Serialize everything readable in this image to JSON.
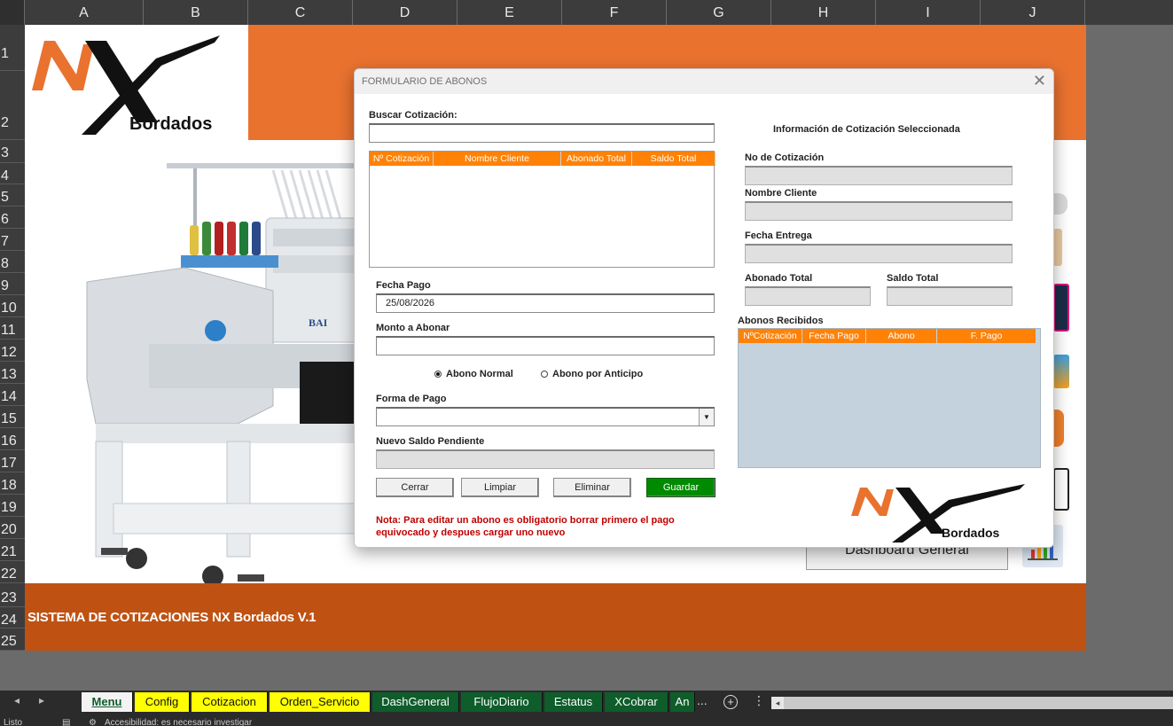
{
  "spreadsheet": {
    "columns": [
      "A",
      "B",
      "C",
      "D",
      "E",
      "F",
      "G",
      "H",
      "I",
      "J"
    ],
    "rows": [
      "1",
      "2",
      "3",
      "4",
      "5",
      "6",
      "7",
      "8",
      "9",
      "10",
      "11",
      "12",
      "13",
      "14",
      "15",
      "16",
      "17",
      "18",
      "19",
      "20",
      "21",
      "22",
      "23",
      "24",
      "25"
    ],
    "footer_title": "SISTEMA DE COTIZACIONES NX Bordados V.1",
    "dashboard_button": "Dashboard General",
    "logo_text": "Bordados",
    "colors": {
      "orange": "#e9722f",
      "footer": "#bf5212",
      "accent": "#ff8207"
    }
  },
  "dialog": {
    "title": "FORMULARIO DE ABONOS",
    "search_label": "Buscar Cotización:",
    "search_value": "",
    "list_columns": [
      "Nº Cotización",
      "Nombre Cliente",
      "Abonado Total",
      "Saldo Total"
    ],
    "fecha_pago_label": "Fecha Pago",
    "fecha_pago_value": "25/08/2026",
    "monto_label": "Monto a Abonar",
    "monto_value": "",
    "radio_normal": "Abono Normal",
    "radio_anticipo": "Abono por Anticipo",
    "forma_pago_label": "Forma de Pago",
    "forma_pago_value": "",
    "nuevo_saldo_label": "Nuevo Saldo Pendiente",
    "buttons": {
      "cerrar": "Cerrar",
      "limpiar": "Limpiar",
      "eliminar": "Eliminar",
      "guardar": "Guardar"
    },
    "note": "Nota: Para editar un abono es obligatorio borrar primero el pago equivocado y despues cargar uno nuevo",
    "info_title": "Información de Cotización Seleccionada",
    "no_cotizacion_label": "No de Cotización",
    "nombre_cliente_label": "Nombre Cliente",
    "fecha_entrega_label": "Fecha Entrega",
    "abonado_total_label": "Abonado Total",
    "saldo_total_label": "Saldo Total",
    "abonos_label": "Abonos Recibidos",
    "abonos_columns": [
      "NºCotización",
      "Fecha Pago",
      "Abono",
      "F. Pago"
    ],
    "logo_text": "Bordados"
  },
  "tabs": [
    {
      "label": "Menu",
      "style": "active"
    },
    {
      "label": "Config",
      "style": "yellow"
    },
    {
      "label": "Cotizacion",
      "style": "yellow"
    },
    {
      "label": "Orden_Servicio",
      "style": "yellow"
    },
    {
      "label": "DashGeneral",
      "style": "green"
    },
    {
      "label": "FlujoDiario",
      "style": "green"
    },
    {
      "label": "Estatus",
      "style": "green"
    },
    {
      "label": "XCobrar",
      "style": "green"
    },
    {
      "label": "An",
      "style": "green"
    }
  ],
  "tab_more": "...",
  "status": {
    "ready": "Listo",
    "accessibility": "Accesibilidad: es necesario investigar"
  }
}
